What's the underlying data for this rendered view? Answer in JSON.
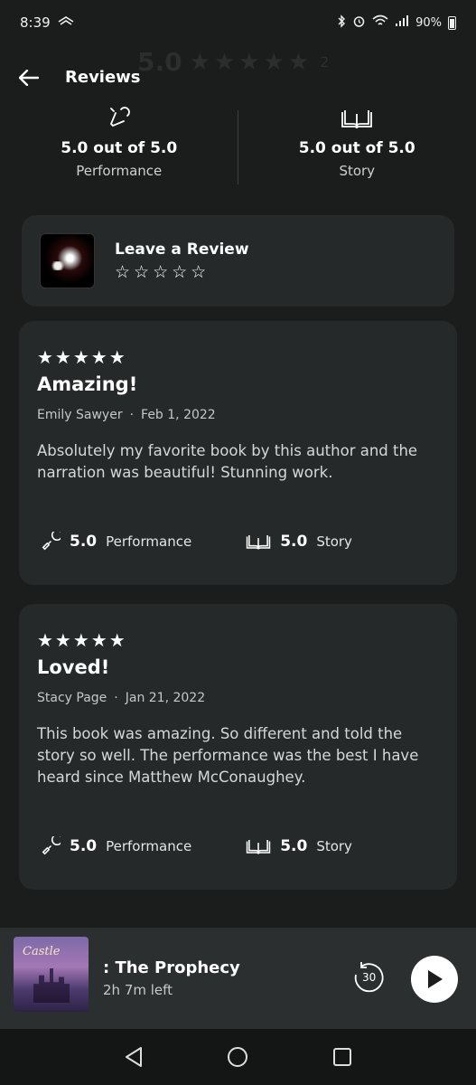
{
  "status_bar": {
    "time": "8:39",
    "battery": "90%"
  },
  "header": {
    "title": "Reviews",
    "ghost_rating": "5.0",
    "ghost_stars": "★★★★★",
    "ghost_count": "2"
  },
  "summary": {
    "performance": {
      "value": "5.0 out of 5.0",
      "label": "Performance",
      "icon": "microphone-icon"
    },
    "story": {
      "value": "5.0 out of 5.0",
      "label": "Story",
      "icon": "book-icon"
    }
  },
  "leave_review": {
    "title": "Leave a Review",
    "stars": "☆☆☆☆☆"
  },
  "reviews": [
    {
      "stars": "★★★★★",
      "title": "Amazing!",
      "author": "Emily Sawyer",
      "separator": "·",
      "date": "Feb 1, 2022",
      "body": "Absolutely my favorite book by this author and the narration was beautiful! Stunning work.",
      "performance_score": "5.0",
      "performance_label": "Performance",
      "story_score": "5.0",
      "story_label": "Story"
    },
    {
      "stars": "★★★★★",
      "title": "Loved!",
      "author": "Stacy Page",
      "separator": "·",
      "date": "Jan 21, 2022",
      "body": "This book was amazing. So different and told the story so well. The performance was the best I have heard since Matthew McConaughey.",
      "performance_score": "5.0",
      "performance_label": "Performance",
      "story_score": "5.0",
      "story_label": "Story"
    }
  ],
  "player": {
    "cover_text": "Castle",
    "title": ": The Prophecy",
    "time_left": "2h 7m left",
    "skip_seconds": "30"
  }
}
